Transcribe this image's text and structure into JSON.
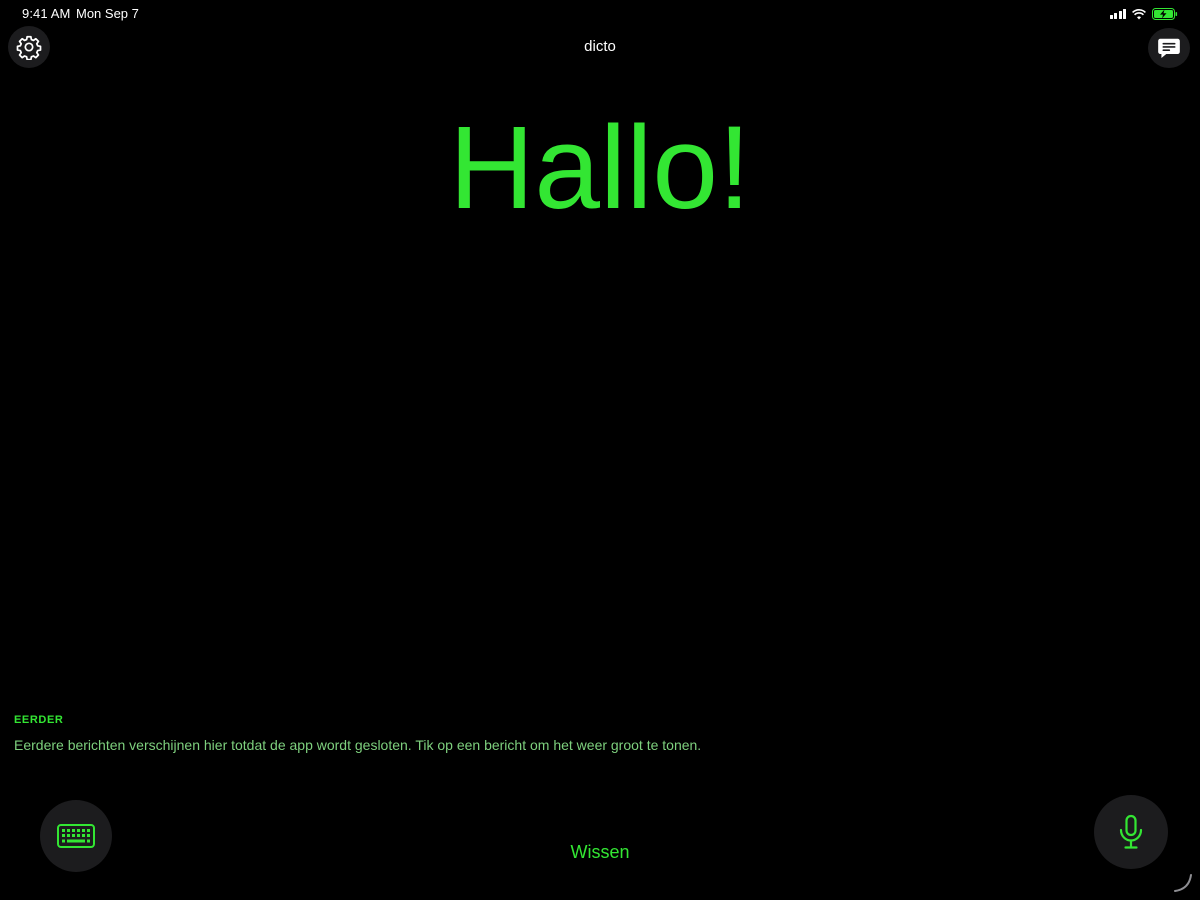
{
  "status_bar": {
    "time": "9:41 AM",
    "date": "Mon Sep 7",
    "signal_icon": "cellular-signal-icon",
    "wifi_icon": "wifi-icon",
    "battery_icon": "battery-charging-icon"
  },
  "header": {
    "title": "dicto",
    "settings_icon": "gear-icon",
    "messages_icon": "chat-bubble-icon"
  },
  "main": {
    "message": "Hallo!"
  },
  "earlier": {
    "heading": "EERDER",
    "description": "Eerdere berichten verschijnen hier totdat de app wordt gesloten. Tik op een bericht om het weer groot te tonen."
  },
  "controls": {
    "keyboard_icon": "keyboard-icon",
    "clear_label": "Wissen",
    "mic_icon": "microphone-icon"
  },
  "colors": {
    "accent": "#33e633",
    "background": "#000000",
    "button_background": "#1c1c1e"
  }
}
